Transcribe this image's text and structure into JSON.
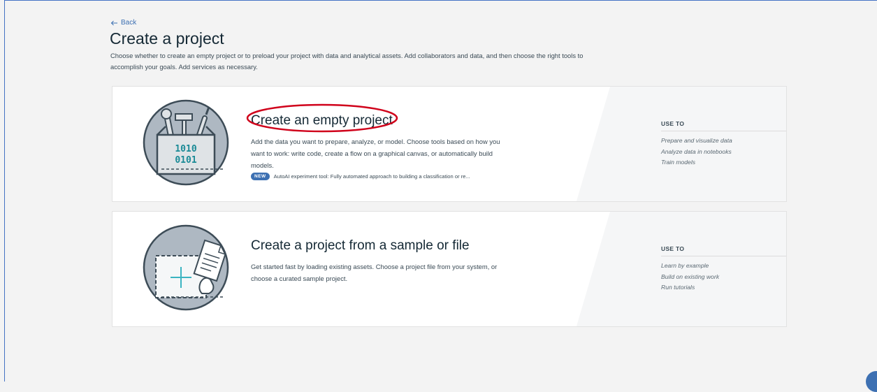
{
  "header": {
    "back_label": "Back",
    "title": "Create a project",
    "description": "Choose whether to create an empty project or to preload your project with data and analytical assets. Add collaborators and data, and then choose the right tools to accomplish your goals. Add services as necessary."
  },
  "cards": [
    {
      "title": "Create an empty project",
      "description": "Add the data you want to prepare, analyze, or model. Choose tools based on how you want to work: write code, create a flow on a graphical canvas, or automatically build models.",
      "badge": "NEW",
      "badge_text": "AutoAI experiment tool: Fully automated approach to building a classification or re...",
      "illustration_text": [
        "1010",
        "0101"
      ],
      "use_to_label": "USE TO",
      "use_to": [
        "Prepare and visualize data",
        "Analyze data in notebooks",
        "Train models"
      ]
    },
    {
      "title": "Create a project from a sample or file",
      "description": "Get started fast by loading existing assets. Choose a project file from your system, or choose a curated sample project.",
      "use_to_label": "USE TO",
      "use_to": [
        "Learn by example",
        "Build on existing work",
        "Run tutorials"
      ]
    }
  ],
  "colors": {
    "accent": "#3d70b2",
    "teal": "#3bb4c1",
    "annotation": "#d0021b"
  }
}
